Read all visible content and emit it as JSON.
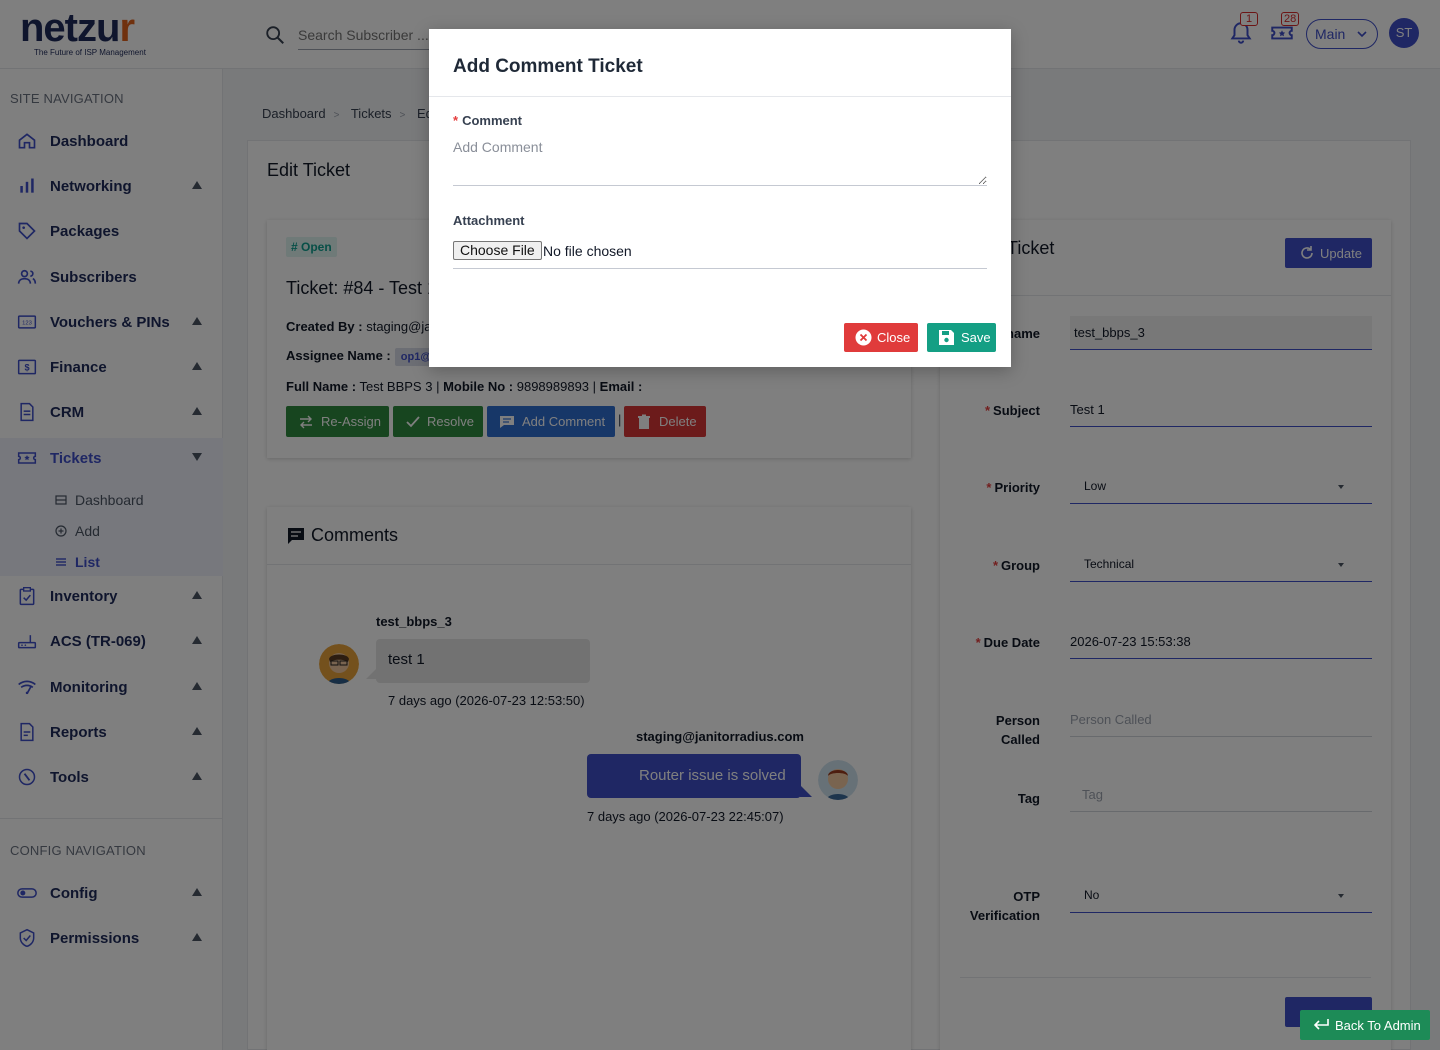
{
  "header": {
    "logo_text": "netzur",
    "logo_tagline": "The Future of ISP Management",
    "search_placeholder": "Search Subscriber ...",
    "notification_count": "1",
    "tickets_count": "28",
    "account_selector": "Main",
    "user_initials": "ST",
    "colors": {
      "brand": "#3e4ec8",
      "logo_accent": "#e0621d"
    }
  },
  "sidebar": {
    "site_nav_title": "SITE NAVIGATION",
    "items": [
      {
        "label": "Dashboard",
        "icon": "home-icon",
        "expandable": false
      },
      {
        "label": "Networking",
        "icon": "bar-chart-icon",
        "expandable": true
      },
      {
        "label": "Packages",
        "icon": "tag-icon",
        "expandable": false
      },
      {
        "label": "Subscribers",
        "icon": "users-icon",
        "expandable": false
      },
      {
        "label": "Vouchers & PINs",
        "icon": "voucher-icon",
        "expandable": true
      },
      {
        "label": "Finance",
        "icon": "dollar-icon",
        "expandable": true
      },
      {
        "label": "CRM",
        "icon": "document-icon",
        "expandable": true
      },
      {
        "label": "Tickets",
        "icon": "ticket-icon",
        "expandable": true,
        "active": true
      },
      {
        "label": "Inventory",
        "icon": "clipboard-icon",
        "expandable": true
      },
      {
        "label": "ACS (TR-069)",
        "icon": "router-icon",
        "expandable": true
      },
      {
        "label": "Monitoring",
        "icon": "wifi-icon",
        "expandable": true
      },
      {
        "label": "Reports",
        "icon": "report-icon",
        "expandable": true
      },
      {
        "label": "Tools",
        "icon": "tools-icon",
        "expandable": true
      }
    ],
    "tickets_sub": [
      {
        "label": "Dashboard",
        "icon": "square-icon"
      },
      {
        "label": "Add",
        "icon": "plus-circle-icon"
      },
      {
        "label": "List",
        "icon": "list-icon",
        "active": true
      }
    ],
    "config_nav_title": "CONFIG NAVIGATION",
    "config_items": [
      {
        "label": "Config",
        "icon": "toggle-icon"
      },
      {
        "label": "Permissions",
        "icon": "shield-check-icon"
      }
    ]
  },
  "breadcrumb": [
    "Dashboard",
    "Tickets",
    "Ed"
  ],
  "page_title": "Edit Ticket",
  "ticket": {
    "status": "# Open",
    "title": "Ticket: #84 - Test 1",
    "created_by_label": "Created By :",
    "created_by_value": "staging@ja",
    "assignee_label": "Assignee Name :",
    "assignee_value": "op1@",
    "full_name_label": "Full Name :",
    "full_name_value": "Test BBPS 3",
    "mobile_label": "Mobile No :",
    "mobile_value": "9898989893",
    "email_label": "Email :",
    "buttons": {
      "reassign": "Re-Assign",
      "resolve": "Resolve",
      "add_comment": "Add Comment",
      "delete": "Delete"
    }
  },
  "comments": {
    "title": "Comments",
    "items": [
      {
        "user": "test_bbps_3",
        "text": "test 1",
        "time": "7 days ago (2026-07-23 12:53:50)"
      },
      {
        "user": "staging@janitorradius.com",
        "text": "Router issue is solved",
        "time": "7 days ago (2026-07-23 22:45:07)"
      }
    ]
  },
  "form": {
    "title": "Ticket",
    "update_label": "Update",
    "fields": {
      "username": {
        "label": "name",
        "value": "test_bbps_3"
      },
      "subject": {
        "label": "Subject",
        "value": "Test 1"
      },
      "priority": {
        "label": "Priority",
        "value": "Low"
      },
      "group": {
        "label": "Group",
        "value": "Technical"
      },
      "due_date": {
        "label": "Due Date",
        "value": "2026-07-23 15:53:38"
      },
      "person_called": {
        "label_1": "Person",
        "label_2": "Called",
        "placeholder": "Person Called"
      },
      "tag": {
        "label": "Tag",
        "placeholder": "Tag"
      },
      "otp": {
        "label_1": "OTP",
        "label_2": "Verification",
        "value": "No"
      }
    }
  },
  "back_to_admin": "Back To Admin",
  "modal": {
    "title": "Add Comment Ticket",
    "comment_label": "Comment",
    "comment_placeholder": "Add Comment",
    "attachment_label": "Attachment",
    "choose_file": "Choose File",
    "file_status": "No file chosen",
    "close_label": "Close",
    "save_label": "Save"
  }
}
